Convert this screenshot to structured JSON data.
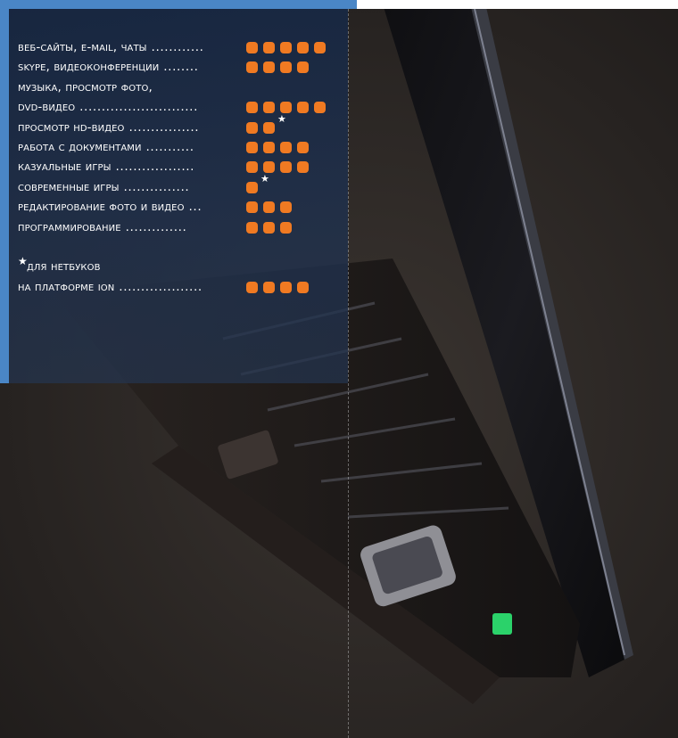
{
  "rating": {
    "rows": [
      {
        "label": "Веб-сайты, e-mail, чаты",
        "dots": "............",
        "squares": 5,
        "star": false
      },
      {
        "label": "Skype, видеоконференции",
        "dots": "........",
        "squares": 4,
        "star": false
      },
      {
        "label": "Музыка, просмотр фото,",
        "dots": "",
        "squares": 0,
        "star": false
      },
      {
        "label": "DVD-видео",
        "dots": "...........................",
        "squares": 5,
        "star": false
      },
      {
        "label": "Просмотр HD-видео",
        "dots": "................",
        "squares": 2,
        "star": true
      },
      {
        "label": "Работа с документами",
        "dots": "...........",
        "squares": 4,
        "star": false
      },
      {
        "label": "Казуальные игры",
        "dots": "..................",
        "squares": 4,
        "star": false
      },
      {
        "label": "Современные игры",
        "dots": "...............",
        "squares": 1,
        "star": true
      },
      {
        "label": "Редактирование фото и видео",
        "dots": "...",
        "squares": 3,
        "star": false
      },
      {
        "label": "Программирование",
        "dots": "..............",
        "squares": 3,
        "star": false
      }
    ],
    "footnote": {
      "star_symbol": "★",
      "line1": "Для нетбуков",
      "line2": "на платформе ION",
      "dots": "...................",
      "squares": 4
    }
  },
  "colors": {
    "square": "#f07a22",
    "panel_accent": "#4a86c6"
  }
}
